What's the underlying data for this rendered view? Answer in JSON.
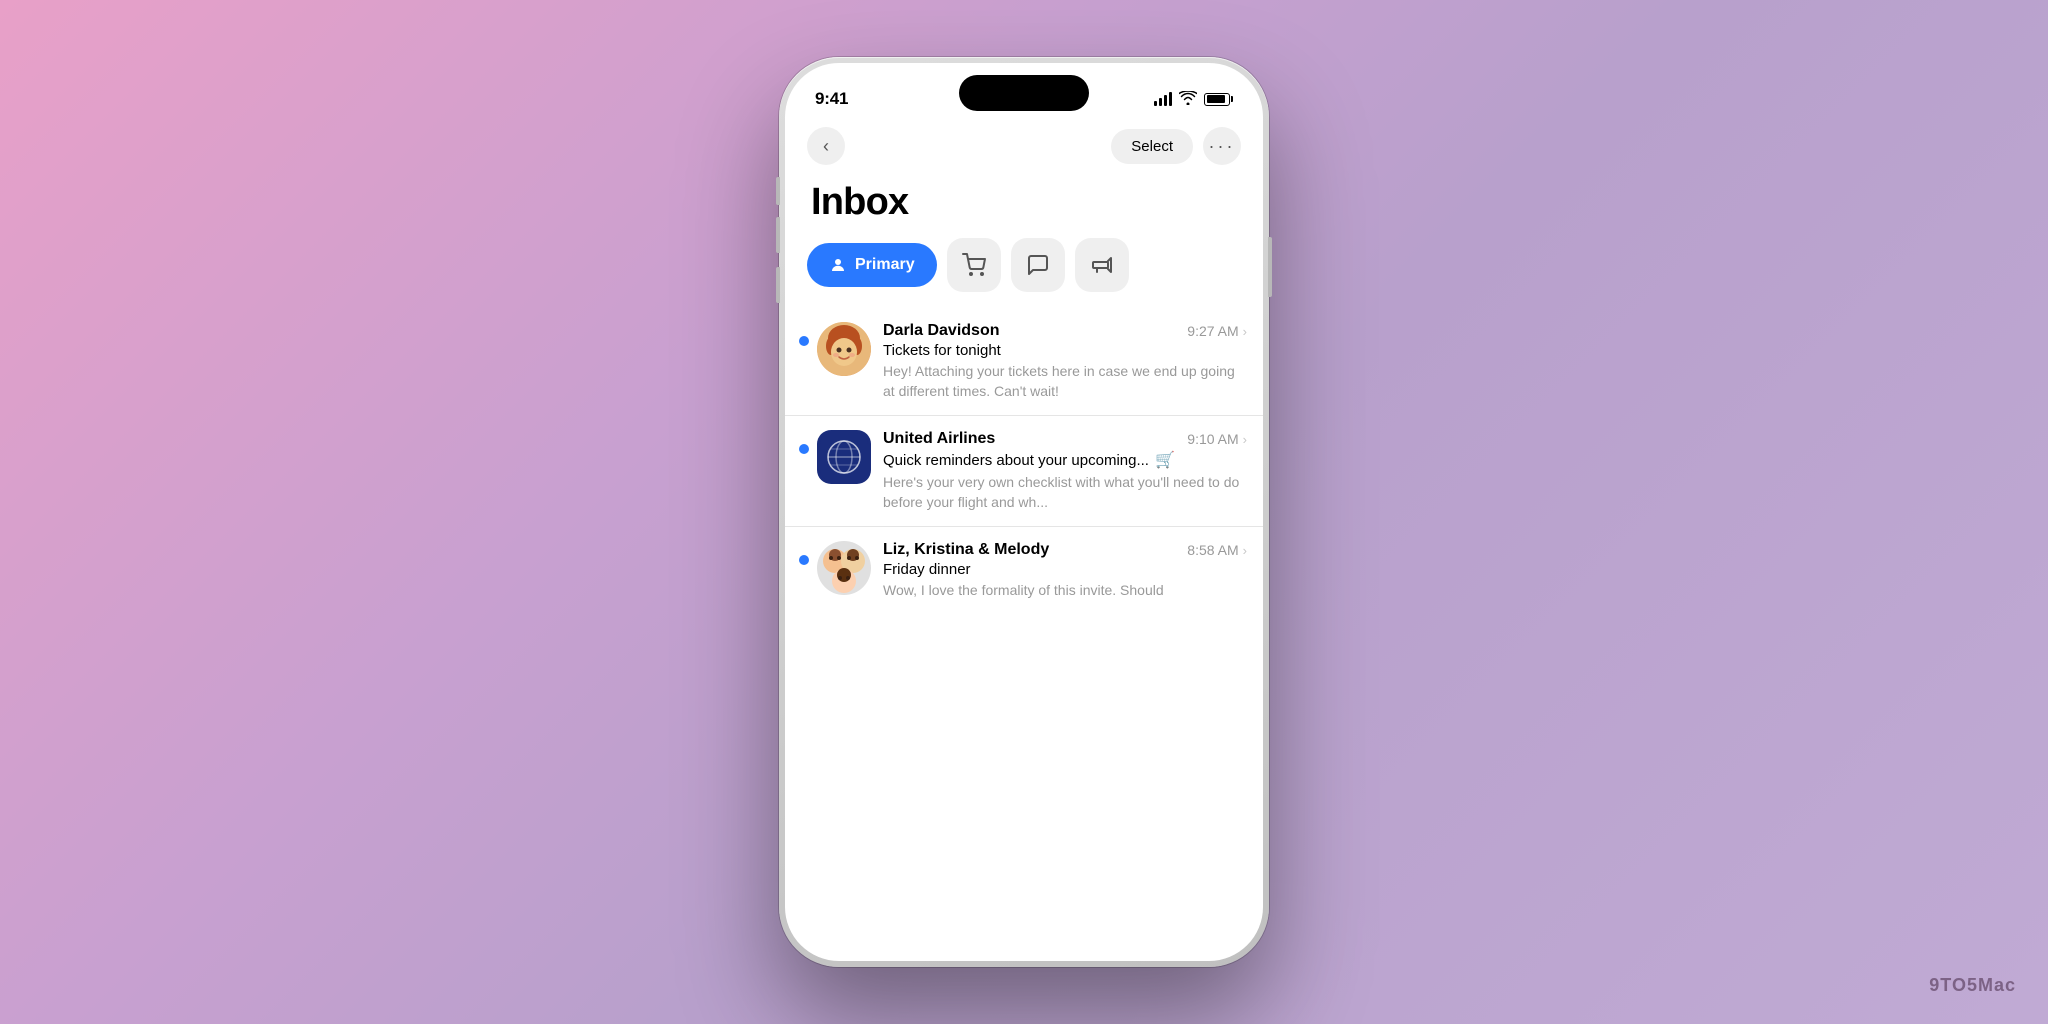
{
  "background": {
    "gradient": "linear-gradient(135deg, #e8a0d0, #b8a0d0)"
  },
  "statusBar": {
    "time": "9:41",
    "signal": "signal",
    "wifi": "wifi",
    "battery": "battery"
  },
  "navbar": {
    "backLabel": "‹",
    "selectLabel": "Select",
    "moreLabel": "···"
  },
  "page": {
    "title": "Inbox"
  },
  "tabs": [
    {
      "id": "primary",
      "label": "Primary",
      "icon": "person",
      "active": true
    },
    {
      "id": "shopping",
      "label": "Shopping",
      "icon": "cart",
      "active": false
    },
    {
      "id": "messages",
      "label": "Messages",
      "icon": "chat",
      "active": false
    },
    {
      "id": "promos",
      "label": "Promotions",
      "icon": "megaphone",
      "active": false
    }
  ],
  "emails": [
    {
      "id": "email-1",
      "unread": true,
      "sender": "Darla Davidson",
      "time": "9:27 AM",
      "subject": "Tickets for tonight",
      "preview": "Hey! Attaching your tickets here in case we end up going at different times. Can't wait!",
      "avatar": "darla",
      "hasShoppingTag": false
    },
    {
      "id": "email-2",
      "unread": true,
      "sender": "United Airlines",
      "time": "9:10 AM",
      "subject": "Quick reminders about your upcoming...",
      "preview": "Here's your very own checklist with what you'll need to do before your flight and wh...",
      "avatar": "united",
      "hasShoppingTag": true
    },
    {
      "id": "email-3",
      "unread": true,
      "sender": "Liz, Kristina & Melody",
      "time": "8:58 AM",
      "subject": "Friday dinner",
      "preview": "Wow, I love the formality of this invite. Should",
      "avatar": "group",
      "hasShoppingTag": false
    }
  ],
  "watermark": "9TO5Mac"
}
